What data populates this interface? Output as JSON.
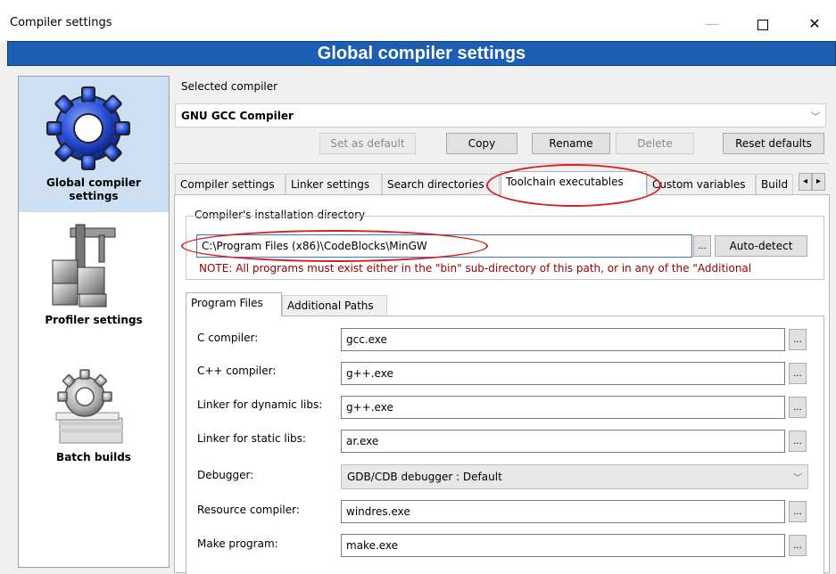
{
  "window": {
    "title": "Compiler settings",
    "controls": {
      "minimize": "—",
      "maximize": "",
      "close": "✕"
    }
  },
  "banner": {
    "title": "Global compiler settings"
  },
  "sidebar": {
    "items": [
      {
        "label_line1": "Global compiler",
        "label_line2": "settings",
        "icon": "gear-icon",
        "selected": true
      },
      {
        "label": "Profiler settings",
        "icon": "caliper-cubes-icon"
      },
      {
        "label": "Batch builds",
        "icon": "gear-stack-icon"
      }
    ]
  },
  "selected_compiler": {
    "label": "Selected compiler",
    "value": "GNU GCC Compiler",
    "buttons": {
      "set_default": "Set as default",
      "copy": "Copy",
      "rename": "Rename",
      "delete": "Delete",
      "reset": "Reset defaults"
    }
  },
  "tabs": [
    "Compiler settings",
    "Linker settings",
    "Search directories",
    "Toolchain executables",
    "Custom variables",
    "Build"
  ],
  "active_tab": "Toolchain executables",
  "tab_scroll": {
    "left": "◂",
    "right": "▸"
  },
  "install_dir": {
    "label": "Compiler's installation directory",
    "value": "C:\\Program Files (x86)\\CodeBlocks\\MinGW",
    "browse": "...",
    "autodetect": "Auto-detect",
    "note": "NOTE: All programs must exist either in the \"bin\" sub-directory of this path, or in any of the \"Additional"
  },
  "subtabs": [
    "Program Files",
    "Additional Paths"
  ],
  "programs": [
    {
      "label": "C compiler:",
      "value": "gcc.exe",
      "type": "text"
    },
    {
      "label": "C++ compiler:",
      "value": "g++.exe",
      "type": "text"
    },
    {
      "label": "Linker for dynamic libs:",
      "value": "g++.exe",
      "type": "text"
    },
    {
      "label": "Linker for static libs:",
      "value": "ar.exe",
      "type": "text"
    },
    {
      "label": "Debugger:",
      "value": "GDB/CDB debugger : Default",
      "type": "select"
    },
    {
      "label": "Resource compiler:",
      "value": "windres.exe",
      "type": "text"
    },
    {
      "label": "Make program:",
      "value": "make.exe",
      "type": "text"
    }
  ],
  "browse_label": "...",
  "colors": {
    "banner": "#1a5fb4",
    "note": "#a00000",
    "highlight": "#d8201f",
    "selection": "#cde0f3"
  }
}
